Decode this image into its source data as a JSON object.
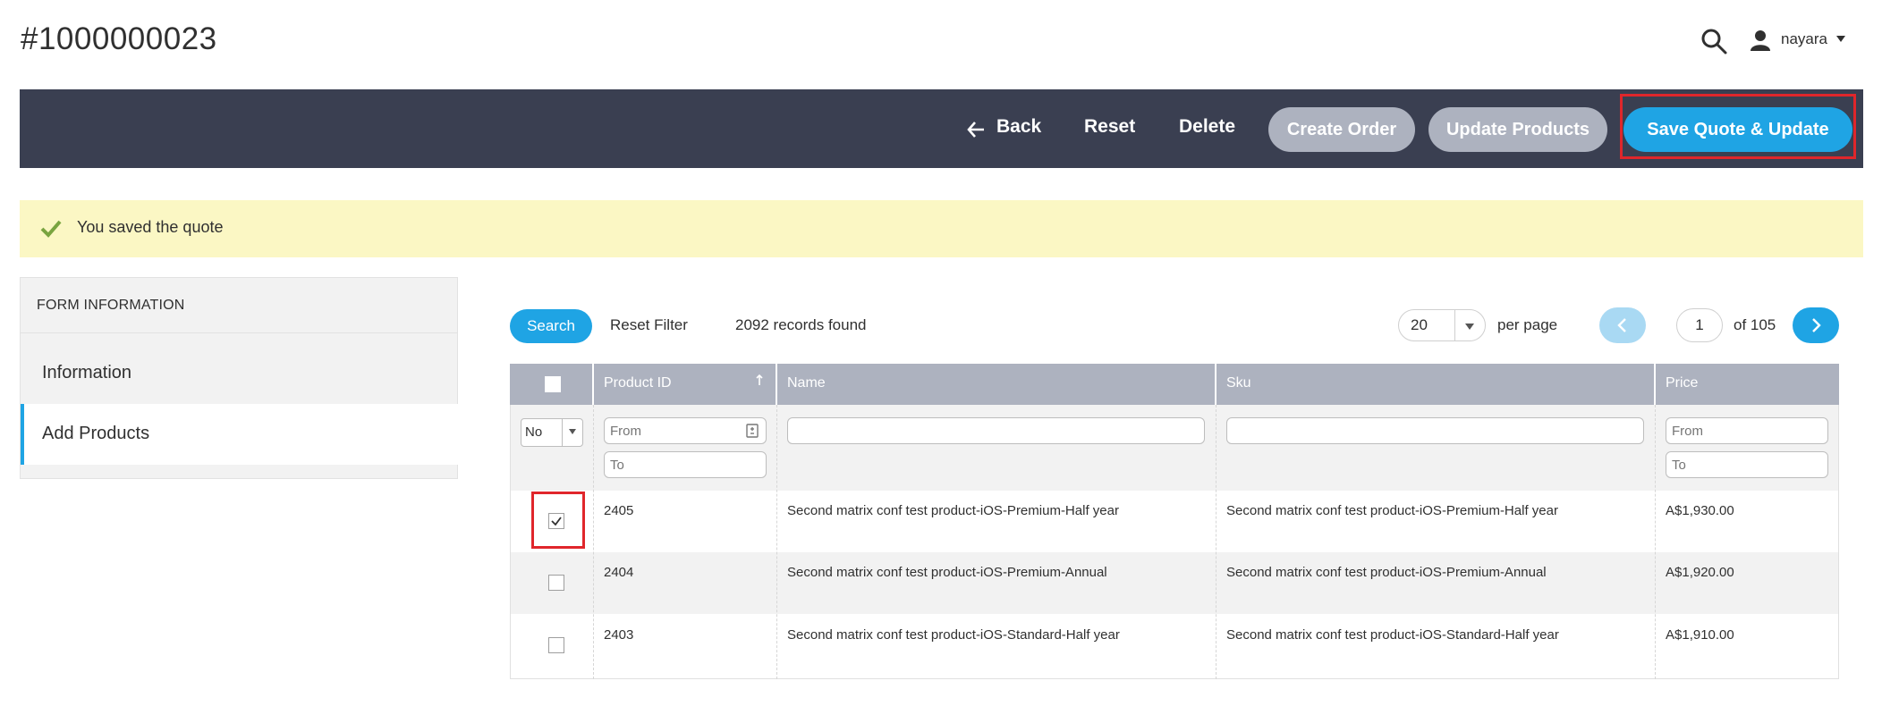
{
  "header": {
    "title": "#1000000023",
    "user": "nayara",
    "icons": [
      "search-icon",
      "user-icon",
      "chevron-down-icon"
    ]
  },
  "toolbar": {
    "back": "Back",
    "reset": "Reset",
    "delete": "Delete",
    "create_order": "Create Order",
    "update_products": "Update Products",
    "save_quote": "Save Quote & Update"
  },
  "message": {
    "text": "You saved the quote"
  },
  "sidebar": {
    "heading": "FORM INFORMATION",
    "items": [
      {
        "label": "Information",
        "active": false
      },
      {
        "label": "Add Products",
        "active": true
      }
    ]
  },
  "grid": {
    "search_label": "Search",
    "reset_filter_label": "Reset Filter",
    "records": "2092 records found",
    "per_page_value": "20",
    "per_page_label": "per page",
    "page": "1",
    "of_pages": "of 105",
    "columns": [
      "Product ID",
      "Name",
      "Sku",
      "Price"
    ],
    "filters": {
      "in_products": "No",
      "id_from": "From",
      "id_to": "To",
      "price_from": "From",
      "price_to": "To"
    },
    "rows": [
      {
        "checked": true,
        "id": "2405",
        "name": "Second matrix conf test product-iOS-Premium-Half year",
        "sku": "Second matrix conf test product-iOS-Premium-Half year",
        "price": "A$1,930.00"
      },
      {
        "checked": false,
        "id": "2404",
        "name": "Second matrix conf test product-iOS-Premium-Annual",
        "sku": "Second matrix conf test product-iOS-Premium-Annual",
        "price": "A$1,920.00"
      },
      {
        "checked": false,
        "id": "2403",
        "name": "Second matrix conf test product-iOS-Standard-Half year",
        "sku": "Second matrix conf test product-iOS-Standard-Half year",
        "price": "A$1,910.00"
      }
    ]
  },
  "colors": {
    "toolbar_bg": "#3a3f51",
    "accent": "#1fa4e4",
    "disabled_button": "#adb2bf",
    "success_bg": "#fbf7c4",
    "success_check": "#79a440",
    "highlight": "#e0262b"
  }
}
